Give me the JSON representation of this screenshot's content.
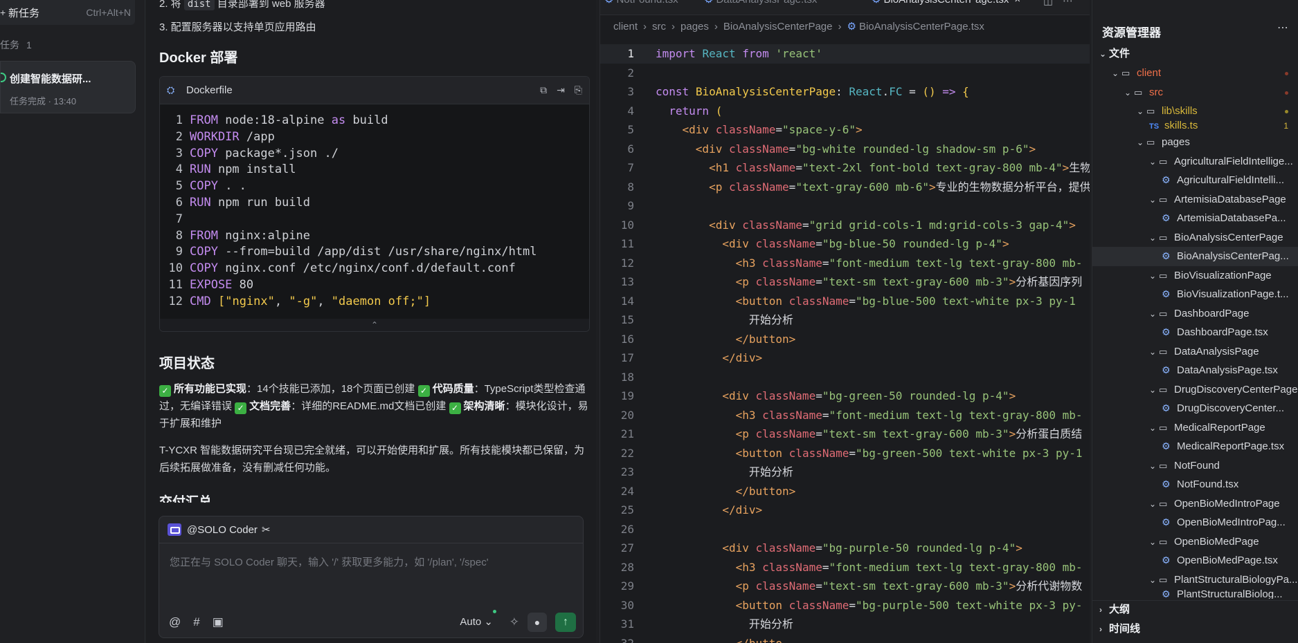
{
  "sidebar": {
    "new_task_label": "新任务",
    "new_task_shortcut": "Ctrl+Alt+N",
    "tasks_label": "任务",
    "tasks_count": "1",
    "task_title": "创建智能数据研...",
    "task_status": "任务完成 · 13:40"
  },
  "chat": {
    "step2_prefix": "2. 将",
    "step2_code": "dist",
    "step2_suffix": "目录部署到 web 服务器",
    "step3": "3. 配置服务器以支持单页应用路由",
    "docker_heading": "Docker 部署",
    "code_filename": "Dockerfile",
    "code_lines": [
      {
        "n": "1",
        "kw": "FROM",
        "rest": " node:18-alpine ",
        "kw2": "as",
        "rest2": " build"
      },
      {
        "n": "2",
        "kw": "WORKDIR",
        "rest": " /app"
      },
      {
        "n": "3",
        "kw": "COPY",
        "rest": " package*.json ./"
      },
      {
        "n": "4",
        "kw": "RUN",
        "rest": " npm install"
      },
      {
        "n": "5",
        "kw": "COPY",
        "rest": " . ."
      },
      {
        "n": "6",
        "kw": "RUN",
        "rest": " npm run build"
      },
      {
        "n": "7",
        "kw": "",
        "rest": ""
      },
      {
        "n": "8",
        "kw": "FROM",
        "rest": " nginx:alpine"
      },
      {
        "n": "9",
        "kw": "COPY",
        "rest": " --from=build /app/dist /usr/share/nginx/html"
      },
      {
        "n": "10",
        "kw": "COPY",
        "rest": " nginx.conf /etc/nginx/conf.d/default.conf"
      },
      {
        "n": "11",
        "kw": "EXPOSE",
        "rest": " 80"
      },
      {
        "n": "12",
        "kw": "CMD",
        "rest": " ",
        "arr": [
          "[",
          "\"nginx\"",
          ", ",
          "\"-g\"",
          ", ",
          "\"daemon off;\"",
          "]"
        ]
      }
    ],
    "status_heading": "项目状态",
    "status_items": [
      {
        "bold": "所有功能已实现",
        "text": "：14个技能已添加，18个页面已创建 "
      },
      {
        "bold": "代码质量",
        "text": "：TypeScript类型检查通过，无编译错误 "
      },
      {
        "bold": "文档完善",
        "text": "：详细的README.md文档已创建 "
      },
      {
        "bold": "架构清晰",
        "text": "：模块化设计，易于扩展和维护"
      }
    ],
    "summary": "T-YCXR 智能数据研究平台现已完全就绪，可以开始使用和扩展。所有技能模块都已保留，为后续拓展做准备，没有删减任何功能。",
    "partial_heading": "交付汇总",
    "composer": {
      "agent": "@SOLO Coder",
      "placeholder": "您正在与 SOLO Coder 聊天，输入 '/' 获取更多能力，如 '/plan', '/spec'",
      "model": "Auto"
    }
  },
  "editor": {
    "tabs": [
      {
        "label": "NotFound.tsx",
        "active": false
      },
      {
        "label": "DataAnalysisPage.tsx",
        "active": false
      },
      {
        "label": "BioAnalysisCenterPage.tsx",
        "active": true
      }
    ],
    "breadcrumb": [
      "client",
      "src",
      "pages",
      "BioAnalysisCenterPage",
      "BioAnalysisCenterPage.tsx"
    ],
    "current_line": 1
  },
  "explorer": {
    "title": "资源管理器",
    "files_section": "文件",
    "outline_section": "大纲",
    "timeline_section": "时间线",
    "tree": [
      {
        "label": "client",
        "kind": "folder",
        "depth": 1,
        "state": "err",
        "mark": "dot-red"
      },
      {
        "label": "src",
        "kind": "folder",
        "depth": 2,
        "state": "err",
        "mark": "dot-red"
      },
      {
        "label": "lib\\skills",
        "kind": "folder",
        "depth": 3,
        "state": "warn",
        "mark": "dot-yellow"
      },
      {
        "label": "skills.ts",
        "kind": "ts",
        "depth": 4,
        "state": "warn",
        "mark": "1",
        "partial": true
      },
      {
        "label": "pages",
        "kind": "folder",
        "depth": 3
      },
      {
        "label": "AgriculturalFieldIntellige...",
        "kind": "folder",
        "depth": 4
      },
      {
        "label": "AgriculturalFieldIntelli...",
        "kind": "tsx",
        "depth": 5
      },
      {
        "label": "ArtemisiaDatabasePage",
        "kind": "folder",
        "depth": 4
      },
      {
        "label": "ArtemisiaDatabasePa...",
        "kind": "tsx",
        "depth": 5
      },
      {
        "label": "BioAnalysisCenterPage",
        "kind": "folder",
        "depth": 4
      },
      {
        "label": "BioAnalysisCenterPag...",
        "kind": "tsx",
        "depth": 5,
        "selected": true
      },
      {
        "label": "BioVisualizationPage",
        "kind": "folder",
        "depth": 4
      },
      {
        "label": "BioVisualizationPage.t...",
        "kind": "tsx",
        "depth": 5
      },
      {
        "label": "DashboardPage",
        "kind": "folder",
        "depth": 4
      },
      {
        "label": "DashboardPage.tsx",
        "kind": "tsx",
        "depth": 5
      },
      {
        "label": "DataAnalysisPage",
        "kind": "folder",
        "depth": 4
      },
      {
        "label": "DataAnalysisPage.tsx",
        "kind": "tsx",
        "depth": 5
      },
      {
        "label": "DrugDiscoveryCenterPage",
        "kind": "folder",
        "depth": 4
      },
      {
        "label": "DrugDiscoveryCenter...",
        "kind": "tsx",
        "depth": 5
      },
      {
        "label": "MedicalReportPage",
        "kind": "folder",
        "depth": 4
      },
      {
        "label": "MedicalReportPage.tsx",
        "kind": "tsx",
        "depth": 5
      },
      {
        "label": "NotFound",
        "kind": "folder",
        "depth": 4
      },
      {
        "label": "NotFound.tsx",
        "kind": "tsx",
        "depth": 5
      },
      {
        "label": "OpenBioMedIntroPage",
        "kind": "folder",
        "depth": 4
      },
      {
        "label": "OpenBioMedIntroPag...",
        "kind": "tsx",
        "depth": 5
      },
      {
        "label": "OpenBioMedPage",
        "kind": "folder",
        "depth": 4
      },
      {
        "label": "OpenBioMedPage.tsx",
        "kind": "tsx",
        "depth": 5
      },
      {
        "label": "PlantStructuralBiologyPa...",
        "kind": "folder",
        "depth": 4
      },
      {
        "label": "PlantStructuralBiolog...",
        "kind": "tsx",
        "depth": 5,
        "partial": true
      }
    ]
  }
}
